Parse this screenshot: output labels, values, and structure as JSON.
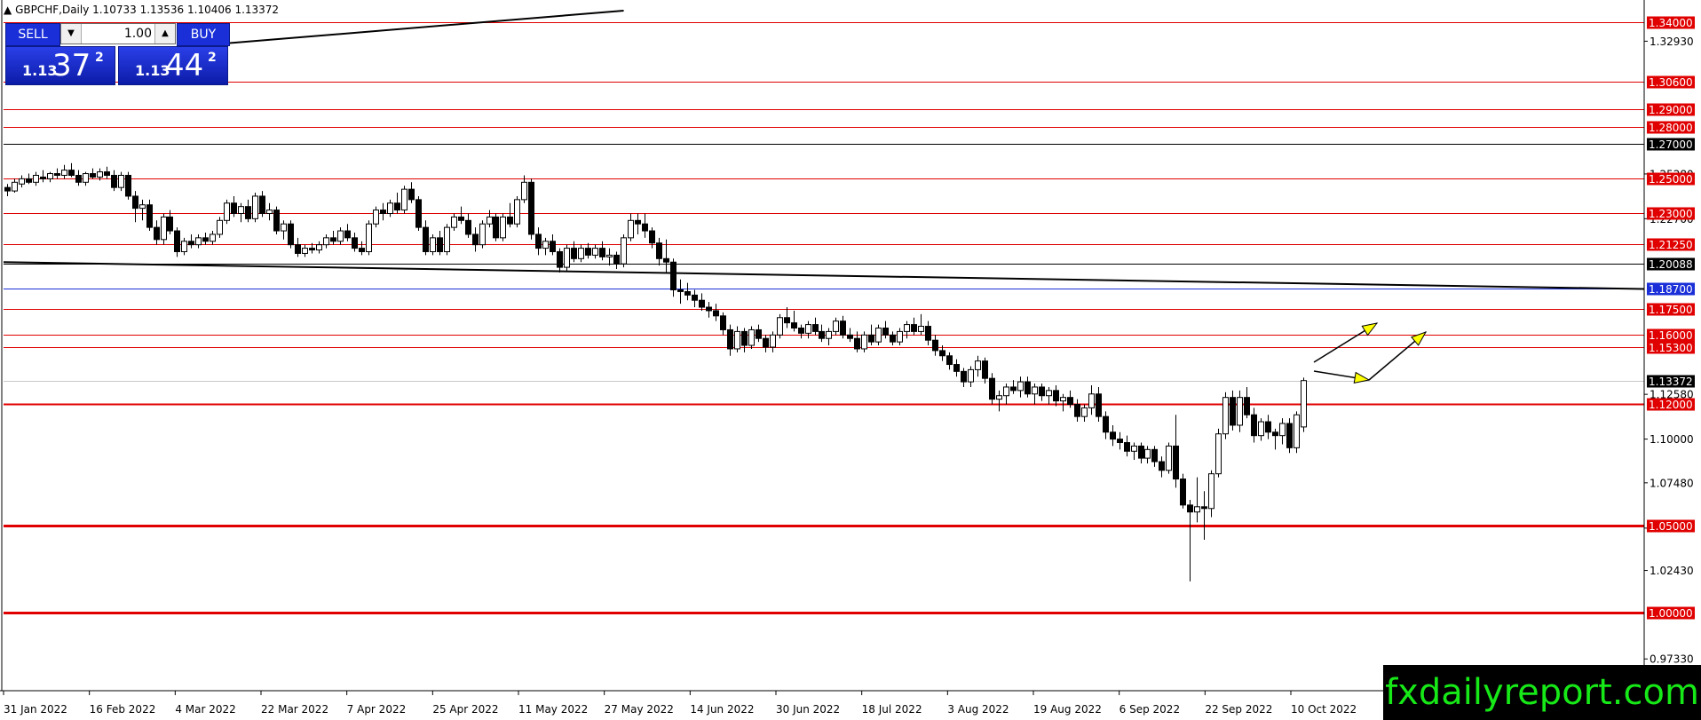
{
  "symbol_info": "GBPCHF,Daily  1.10733 1.13536 1.10406 1.13372",
  "trade_panel": {
    "sell_label": "SELL",
    "buy_label": "BUY",
    "lot": "1.00",
    "sell_price": {
      "prefix": "1.13",
      "big": "37",
      "sup": "2"
    },
    "buy_price": {
      "prefix": "1.13",
      "big": "44",
      "sup": "2"
    }
  },
  "watermark": "fxdailyreport.com",
  "colors": {
    "bull": "#ffffff",
    "bear": "#000000",
    "level": "#e00000",
    "badge_red": "#e00000",
    "badge_black": "#000000",
    "badge_blue": "#1a2fd8",
    "arrow_fill": "#ffff00"
  },
  "chart_data": {
    "type": "candlestick",
    "ylim": [
      0.955,
      1.3469
    ],
    "x_ticks": [
      "31 Jan 2022",
      "16 Feb 2022",
      "4 Mar 2022",
      "22 Mar 2022",
      "7 Apr 2022",
      "25 Apr 2022",
      "11 May 2022",
      "27 May 2022",
      "14 Jun 2022",
      "30 Jun 2022",
      "18 Jul 2022",
      "3 Aug 2022",
      "19 Aug 2022",
      "6 Sep 2022",
      "22 Sep 2022",
      "10 Oct 2022"
    ],
    "y_ticks": [
      "1.32930",
      "1.25280",
      "1.22700",
      "1.12580",
      "1.10000",
      "1.07480",
      "1.04870",
      "1.02430",
      "0.97330"
    ],
    "y_tick_values": [
      1.3293,
      1.2528,
      1.227,
      1.1258,
      1.1,
      1.0748,
      1.0487,
      1.0243,
      0.9733
    ],
    "levels": [
      {
        "value": 1.34,
        "label": "1.34000",
        "color": "red",
        "width": 1
      },
      {
        "value": 1.306,
        "label": "1.30600",
        "color": "red",
        "width": 1
      },
      {
        "value": 1.29,
        "label": "1.29000",
        "color": "red",
        "width": 1
      },
      {
        "value": 1.28,
        "label": "1.28000",
        "color": "red",
        "width": 1
      },
      {
        "value": 1.27,
        "label": "1.27000",
        "color": "black",
        "width": 1
      },
      {
        "value": 1.25,
        "label": "1.25000",
        "color": "red",
        "width": 1
      },
      {
        "value": 1.23,
        "label": "1.23000",
        "color": "red",
        "width": 1
      },
      {
        "value": 1.2125,
        "label": "1.21250",
        "color": "red",
        "width": 1
      },
      {
        "value": 1.20088,
        "label": "1.20088",
        "color": "black",
        "width": 1
      },
      {
        "value": 1.187,
        "label": "1.18700",
        "color": "blue",
        "width": 1
      },
      {
        "value": 1.175,
        "label": "1.17500",
        "color": "red",
        "width": 1
      },
      {
        "value": 1.16,
        "label": "1.16000",
        "color": "red",
        "width": 1
      },
      {
        "value": 1.153,
        "label": "1.15300",
        "color": "red",
        "width": 1
      },
      {
        "value": 1.13372,
        "label": "1.13372",
        "color": "current",
        "width": 1
      },
      {
        "value": 1.12,
        "label": "1.12000",
        "color": "red",
        "width": 2
      },
      {
        "value": 1.05,
        "label": "1.05000",
        "color": "red",
        "width": 3
      },
      {
        "value": 1.0,
        "label": "1.00000",
        "color": "red",
        "width": 3
      }
    ],
    "candles": [
      [
        1.245,
        1.247,
        1.24,
        1.243
      ],
      [
        1.243,
        1.25,
        1.242,
        1.248
      ],
      [
        1.247,
        1.252,
        1.245,
        1.25
      ],
      [
        1.25,
        1.253,
        1.247,
        1.248
      ],
      [
        1.248,
        1.254,
        1.246,
        1.252
      ],
      [
        1.251,
        1.255,
        1.248,
        1.25
      ],
      [
        1.25,
        1.254,
        1.248,
        1.253
      ],
      [
        1.253,
        1.256,
        1.25,
        1.252
      ],
      [
        1.252,
        1.258,
        1.25,
        1.255
      ],
      [
        1.255,
        1.259,
        1.251,
        1.252
      ],
      [
        1.252,
        1.255,
        1.246,
        1.248
      ],
      [
        1.248,
        1.254,
        1.246,
        1.253
      ],
      [
        1.253,
        1.256,
        1.25,
        1.251
      ],
      [
        1.251,
        1.256,
        1.249,
        1.254
      ],
      [
        1.254,
        1.257,
        1.25,
        1.252
      ],
      [
        1.252,
        1.255,
        1.243,
        1.245
      ],
      [
        1.245,
        1.254,
        1.243,
        1.252
      ],
      [
        1.252,
        1.254,
        1.238,
        1.24
      ],
      [
        1.24,
        1.243,
        1.225,
        1.233
      ],
      [
        1.233,
        1.238,
        1.226,
        1.235
      ],
      [
        1.235,
        1.238,
        1.22,
        1.222
      ],
      [
        1.222,
        1.226,
        1.212,
        1.215
      ],
      [
        1.215,
        1.23,
        1.212,
        1.228
      ],
      [
        1.228,
        1.232,
        1.218,
        1.22
      ],
      [
        1.22,
        1.222,
        1.205,
        1.208
      ],
      [
        1.208,
        1.216,
        1.206,
        1.214
      ],
      [
        1.214,
        1.218,
        1.21,
        1.212
      ],
      [
        1.212,
        1.218,
        1.21,
        1.216
      ],
      [
        1.216,
        1.219,
        1.212,
        1.214
      ],
      [
        1.214,
        1.22,
        1.212,
        1.218
      ],
      [
        1.218,
        1.228,
        1.216,
        1.226
      ],
      [
        1.226,
        1.238,
        1.224,
        1.236
      ],
      [
        1.236,
        1.24,
        1.228,
        1.23
      ],
      [
        1.23,
        1.236,
        1.225,
        1.234
      ],
      [
        1.234,
        1.238,
        1.225,
        1.227
      ],
      [
        1.227,
        1.242,
        1.225,
        1.24
      ],
      [
        1.24,
        1.243,
        1.228,
        1.23
      ],
      [
        1.23,
        1.236,
        1.226,
        1.232
      ],
      [
        1.232,
        1.234,
        1.218,
        1.22
      ],
      [
        1.22,
        1.226,
        1.215,
        1.224
      ],
      [
        1.224,
        1.226,
        1.21,
        1.212
      ],
      [
        1.212,
        1.216,
        1.205,
        1.207
      ],
      [
        1.207,
        1.212,
        1.205,
        1.21
      ],
      [
        1.21,
        1.213,
        1.207,
        1.209
      ],
      [
        1.209,
        1.214,
        1.207,
        1.212
      ],
      [
        1.212,
        1.218,
        1.21,
        1.216
      ],
      [
        1.216,
        1.22,
        1.212,
        1.214
      ],
      [
        1.214,
        1.222,
        1.212,
        1.22
      ],
      [
        1.22,
        1.224,
        1.214,
        1.216
      ],
      [
        1.216,
        1.219,
        1.208,
        1.21
      ],
      [
        1.21,
        1.214,
        1.206,
        1.208
      ],
      [
        1.208,
        1.226,
        1.206,
        1.224
      ],
      [
        1.224,
        1.234,
        1.222,
        1.232
      ],
      [
        1.232,
        1.236,
        1.226,
        1.23
      ],
      [
        1.23,
        1.238,
        1.228,
        1.236
      ],
      [
        1.236,
        1.242,
        1.23,
        1.232
      ],
      [
        1.232,
        1.246,
        1.23,
        1.244
      ],
      [
        1.244,
        1.248,
        1.236,
        1.238
      ],
      [
        1.238,
        1.24,
        1.22,
        1.222
      ],
      [
        1.222,
        1.226,
        1.206,
        1.208
      ],
      [
        1.208,
        1.218,
        1.206,
        1.216
      ],
      [
        1.216,
        1.22,
        1.206,
        1.208
      ],
      [
        1.208,
        1.224,
        1.206,
        1.222
      ],
      [
        1.222,
        1.23,
        1.22,
        1.228
      ],
      [
        1.228,
        1.234,
        1.224,
        1.226
      ],
      [
        1.226,
        1.23,
        1.216,
        1.218
      ],
      [
        1.218,
        1.222,
        1.208,
        1.212
      ],
      [
        1.212,
        1.226,
        1.21,
        1.224
      ],
      [
        1.224,
        1.232,
        1.222,
        1.228
      ],
      [
        1.228,
        1.23,
        1.214,
        1.216
      ],
      [
        1.216,
        1.23,
        1.214,
        1.228
      ],
      [
        1.228,
        1.236,
        1.222,
        1.224
      ],
      [
        1.224,
        1.24,
        1.222,
        1.238
      ],
      [
        1.238,
        1.252,
        1.236,
        1.248
      ],
      [
        1.248,
        1.25,
        1.215,
        1.218
      ],
      [
        1.218,
        1.222,
        1.206,
        1.21
      ],
      [
        1.21,
        1.216,
        1.206,
        1.214
      ],
      [
        1.214,
        1.218,
        1.206,
        1.208
      ],
      [
        1.208,
        1.21,
        1.196,
        1.199
      ],
      [
        1.199,
        1.212,
        1.197,
        1.21
      ],
      [
        1.21,
        1.214,
        1.202,
        1.204
      ],
      [
        1.204,
        1.212,
        1.202,
        1.21
      ],
      [
        1.21,
        1.213,
        1.204,
        1.206
      ],
      [
        1.206,
        1.212,
        1.204,
        1.21
      ],
      [
        1.21,
        1.214,
        1.203,
        1.205
      ],
      [
        1.205,
        1.21,
        1.2,
        1.206
      ],
      [
        1.206,
        1.208,
        1.198,
        1.201
      ],
      [
        1.201,
        1.218,
        1.199,
        1.216
      ],
      [
        1.216,
        1.23,
        1.214,
        1.226
      ],
      [
        1.226,
        1.23,
        1.218,
        1.224
      ],
      [
        1.224,
        1.23,
        1.216,
        1.22
      ],
      [
        1.22,
        1.222,
        1.21,
        1.213
      ],
      [
        1.213,
        1.216,
        1.2,
        1.204
      ],
      [
        1.204,
        1.215,
        1.196,
        1.202
      ],
      [
        1.202,
        1.204,
        1.182,
        1.186
      ],
      [
        1.186,
        1.192,
        1.178,
        1.185
      ],
      [
        1.185,
        1.19,
        1.18,
        1.183
      ],
      [
        1.183,
        1.186,
        1.176,
        1.18
      ],
      [
        1.18,
        1.184,
        1.174,
        1.176
      ],
      [
        1.176,
        1.179,
        1.17,
        1.174
      ],
      [
        1.174,
        1.178,
        1.168,
        1.171
      ],
      [
        1.171,
        1.173,
        1.16,
        1.163
      ],
      [
        1.163,
        1.166,
        1.148,
        1.152
      ],
      [
        1.152,
        1.165,
        1.15,
        1.162
      ],
      [
        1.162,
        1.164,
        1.15,
        1.154
      ],
      [
        1.154,
        1.165,
        1.152,
        1.163
      ],
      [
        1.163,
        1.166,
        1.156,
        1.158
      ],
      [
        1.158,
        1.16,
        1.15,
        1.153
      ],
      [
        1.153,
        1.162,
        1.15,
        1.16
      ],
      [
        1.16,
        1.172,
        1.158,
        1.17
      ],
      [
        1.17,
        1.176,
        1.164,
        1.167
      ],
      [
        1.167,
        1.174,
        1.162,
        1.164
      ],
      [
        1.164,
        1.166,
        1.158,
        1.161
      ],
      [
        1.161,
        1.168,
        1.158,
        1.166
      ],
      [
        1.166,
        1.17,
        1.16,
        1.162
      ],
      [
        1.162,
        1.166,
        1.156,
        1.158
      ],
      [
        1.158,
        1.164,
        1.154,
        1.162
      ],
      [
        1.162,
        1.17,
        1.16,
        1.168
      ],
      [
        1.168,
        1.171,
        1.158,
        1.16
      ],
      [
        1.16,
        1.164,
        1.156,
        1.158
      ],
      [
        1.158,
        1.162,
        1.15,
        1.152
      ],
      [
        1.152,
        1.162,
        1.15,
        1.16
      ],
      [
        1.16,
        1.166,
        1.154,
        1.156
      ],
      [
        1.156,
        1.166,
        1.154,
        1.164
      ],
      [
        1.164,
        1.168,
        1.158,
        1.16
      ],
      [
        1.16,
        1.162,
        1.154,
        1.156
      ],
      [
        1.156,
        1.164,
        1.154,
        1.162
      ],
      [
        1.162,
        1.168,
        1.158,
        1.166
      ],
      [
        1.166,
        1.17,
        1.16,
        1.162
      ],
      [
        1.162,
        1.172,
        1.16,
        1.165
      ],
      [
        1.165,
        1.168,
        1.154,
        1.157
      ],
      [
        1.157,
        1.16,
        1.148,
        1.151
      ],
      [
        1.151,
        1.154,
        1.145,
        1.148
      ],
      [
        1.148,
        1.15,
        1.14,
        1.143
      ],
      [
        1.143,
        1.146,
        1.136,
        1.139
      ],
      [
        1.139,
        1.141,
        1.13,
        1.133
      ],
      [
        1.133,
        1.142,
        1.13,
        1.14
      ],
      [
        1.14,
        1.148,
        1.136,
        1.145
      ],
      [
        1.145,
        1.147,
        1.132,
        1.135
      ],
      [
        1.135,
        1.138,
        1.12,
        1.123
      ],
      [
        1.123,
        1.128,
        1.116,
        1.125
      ],
      [
        1.125,
        1.132,
        1.12,
        1.13
      ],
      [
        1.13,
        1.134,
        1.126,
        1.128
      ],
      [
        1.128,
        1.136,
        1.124,
        1.133
      ],
      [
        1.133,
        1.136,
        1.124,
        1.126
      ],
      [
        1.126,
        1.132,
        1.12,
        1.13
      ],
      [
        1.13,
        1.132,
        1.122,
        1.125
      ],
      [
        1.125,
        1.13,
        1.12,
        1.128
      ],
      [
        1.128,
        1.131,
        1.119,
        1.122
      ],
      [
        1.122,
        1.126,
        1.116,
        1.124
      ],
      [
        1.124,
        1.128,
        1.118,
        1.12
      ],
      [
        1.12,
        1.123,
        1.11,
        1.113
      ],
      [
        1.113,
        1.12,
        1.11,
        1.118
      ],
      [
        1.118,
        1.131,
        1.114,
        1.126
      ],
      [
        1.126,
        1.13,
        1.11,
        1.113
      ],
      [
        1.113,
        1.116,
        1.1,
        1.104
      ],
      [
        1.104,
        1.108,
        1.096,
        1.1
      ],
      [
        1.1,
        1.104,
        1.094,
        1.098
      ],
      [
        1.098,
        1.102,
        1.09,
        1.093
      ],
      [
        1.093,
        1.098,
        1.088,
        1.096
      ],
      [
        1.096,
        1.098,
        1.086,
        1.089
      ],
      [
        1.089,
        1.096,
        1.086,
        1.094
      ],
      [
        1.094,
        1.096,
        1.084,
        1.087
      ],
      [
        1.087,
        1.09,
        1.078,
        1.082
      ],
      [
        1.082,
        1.098,
        1.08,
        1.096
      ],
      [
        1.096,
        1.114,
        1.072,
        1.077
      ],
      [
        1.077,
        1.08,
        1.06,
        1.062
      ],
      [
        1.062,
        1.065,
        1.018,
        1.058
      ],
      [
        1.058,
        1.078,
        1.052,
        1.061
      ],
      [
        1.061,
        1.07,
        1.042,
        1.06
      ],
      [
        1.06,
        1.082,
        1.055,
        1.08
      ],
      [
        1.08,
        1.106,
        1.078,
        1.103
      ],
      [
        1.103,
        1.127,
        1.1,
        1.124
      ],
      [
        1.124,
        1.128,
        1.105,
        1.108
      ],
      [
        1.108,
        1.128,
        1.104,
        1.124
      ],
      [
        1.124,
        1.13,
        1.112,
        1.114
      ],
      [
        1.114,
        1.118,
        1.098,
        1.102
      ],
      [
        1.102,
        1.112,
        1.099,
        1.11
      ],
      [
        1.11,
        1.114,
        1.1,
        1.104
      ],
      [
        1.104,
        1.106,
        1.094,
        1.102
      ],
      [
        1.102,
        1.112,
        1.097,
        1.109
      ],
      [
        1.109,
        1.112,
        1.092,
        1.095
      ],
      [
        1.095,
        1.116,
        1.092,
        1.114
      ],
      [
        1.107,
        1.1354,
        1.1041,
        1.1337
      ]
    ],
    "trendlines": [
      {
        "from": [
          0.135,
          1.328
        ],
        "to": [
          0.378,
          1.3469
        ]
      },
      {
        "from": [
          0.0,
          1.202
        ],
        "to": [
          1.0,
          1.1865
        ]
      }
    ]
  }
}
